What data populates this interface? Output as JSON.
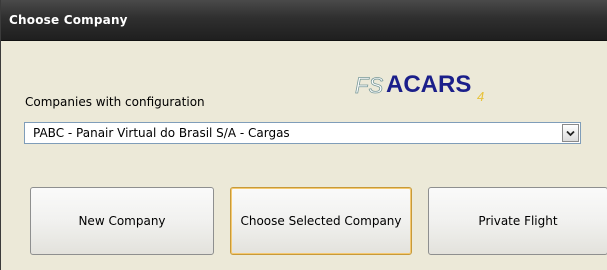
{
  "window": {
    "title": "Choose Company"
  },
  "logo": {
    "prefix": "FS",
    "name": "ACARS",
    "suffix": "4"
  },
  "form": {
    "companies_label": "Companies with configuration",
    "selected_company": "PABC - Panair Virtual do Brasil S/A - Cargas"
  },
  "buttons": {
    "new_company": "New Company",
    "choose_selected": "Choose Selected Company",
    "private_flight": "Private Flight"
  }
}
